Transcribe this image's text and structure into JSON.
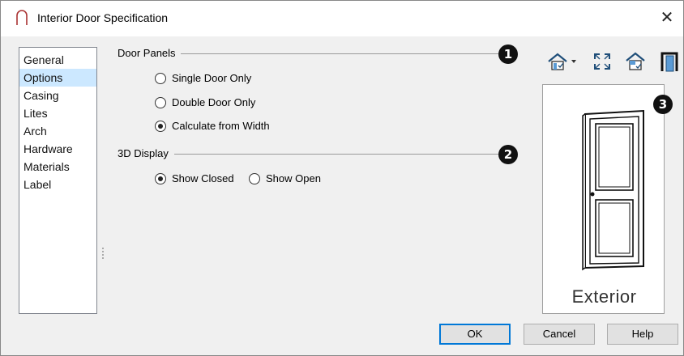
{
  "window": {
    "title": "Interior Door Specification",
    "close_glyph": "✕"
  },
  "sidebar": {
    "items": [
      {
        "label": "General"
      },
      {
        "label": "Options"
      },
      {
        "label": "Casing"
      },
      {
        "label": "Lites"
      },
      {
        "label": "Arch"
      },
      {
        "label": "Hardware"
      },
      {
        "label": "Materials"
      },
      {
        "label": "Label"
      }
    ],
    "selected": "Options"
  },
  "door_panels": {
    "heading": "Door Panels",
    "options": [
      "Single Door Only",
      "Double Door Only",
      "Calculate from Width"
    ],
    "selected": "Calculate from Width"
  },
  "display_3d": {
    "heading": "3D Display",
    "options": [
      "Show Closed",
      "Show Open"
    ],
    "selected": "Show Closed"
  },
  "callouts": [
    "1",
    "2",
    "3"
  ],
  "toolbar": {
    "icons": [
      "view-type-dropdown-icon",
      "fill-window-icon",
      "show-floor-icon",
      "door-frame-icon"
    ]
  },
  "preview": {
    "label": "Exterior"
  },
  "buttons": {
    "ok": "OK",
    "cancel": "Cancel",
    "help": "Help"
  },
  "colors": {
    "selection": "#cce8ff",
    "default_button_border": "#0078d7",
    "callout": "#111111"
  }
}
